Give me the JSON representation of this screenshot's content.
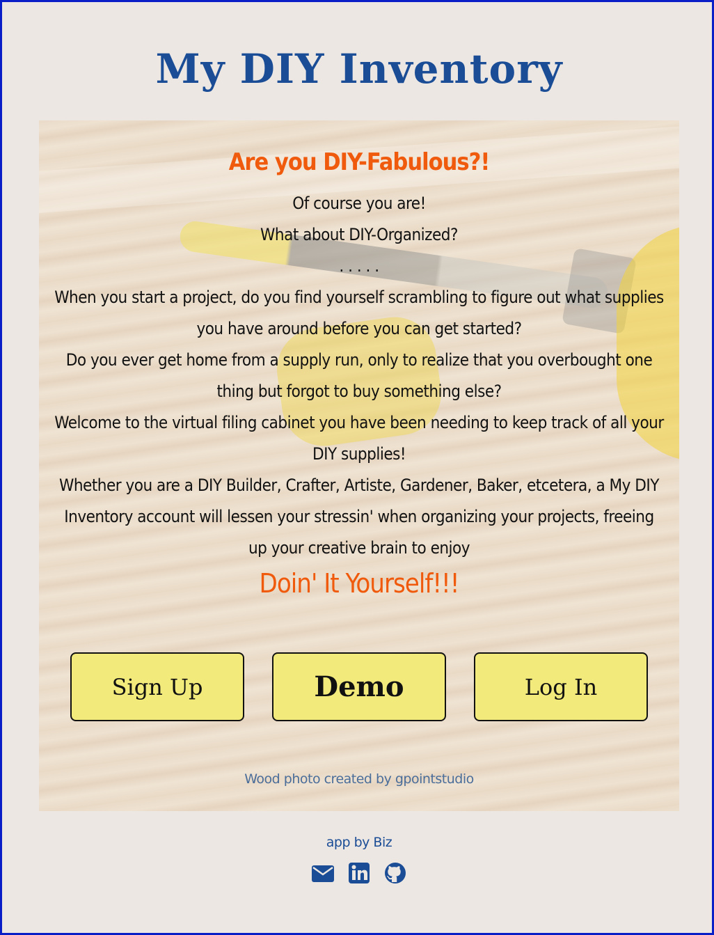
{
  "site": {
    "title": "My DIY Inventory"
  },
  "hero": {
    "tagline": "Are you DIY-Fabulous?!",
    "lines": [
      "Of course you are!",
      "What about DIY-Organized?",
      ". . . . .",
      "When you start a project, do you find yourself scrambling to figure out what supplies you have around before you can get started?",
      "Do you ever get home from a supply run, only to realize that you overbought one thing but forgot to buy something else?",
      "Welcome to the virtual filing cabinet you have been needing to keep track of all your DIY supplies!",
      "Whether you are a DIY Builder, Crafter, Artiste, Gardener, Baker, etcetera, a My DIY Inventory account will lessen your stressin' when organizing your projects, freeing up your creative brain to enjoy"
    ],
    "closing": "Doin' It Yourself!!!",
    "buttons": {
      "signup": "Sign Up",
      "demo": "Demo",
      "login": "Log In"
    },
    "photo_credit": "Wood photo created by gpointstudio"
  },
  "footer": {
    "credit": "app by Biz",
    "icons": [
      "envelope-icon",
      "linkedin-icon",
      "github-icon"
    ]
  },
  "colors": {
    "title": "#1a4d96",
    "accent": "#f05a0c",
    "button": "#f2ea7a",
    "background": "#ece7e3",
    "border": "#0a1ec8"
  }
}
